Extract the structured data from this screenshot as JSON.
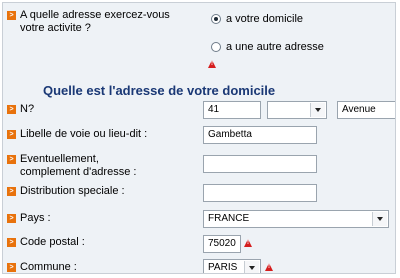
{
  "question": {
    "text": "A quelle adresse exercez-vous votre activite ?",
    "option_home": "a votre domicile",
    "option_other": "a une autre adresse"
  },
  "section": {
    "title": "Quelle est l'adresse de votre domicile"
  },
  "fields": {
    "numero": {
      "label": "N?",
      "value": "41",
      "type_select": "Avenue"
    },
    "libelle": {
      "label": "Libelle de voie ou lieu-dit :",
      "value": "Gambetta"
    },
    "complement": {
      "label": "Eventuellement, complement d'adresse :",
      "value": ""
    },
    "distribution": {
      "label": "Distribution speciale :",
      "value": ""
    },
    "pays": {
      "label": "Pays :",
      "value": "FRANCE"
    },
    "code_postal": {
      "label": "Code postal :",
      "value": "75020"
    },
    "commune": {
      "label": "Commune :",
      "value": "PARIS"
    }
  },
  "colors": {
    "accent": "#e8720c",
    "title": "#1a3875",
    "warning": "#d51d1d",
    "panel": "#eef2f6"
  }
}
